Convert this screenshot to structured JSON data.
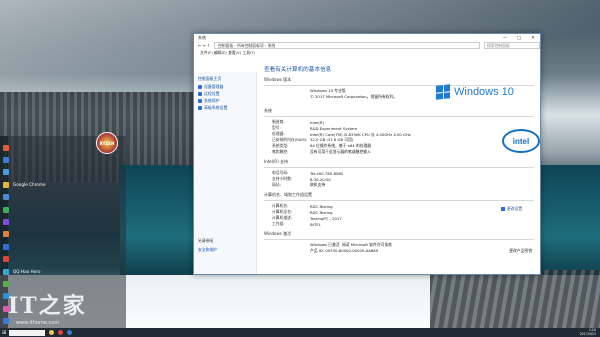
{
  "watermark": {
    "text": "IT之家",
    "site": "www.ithome.com"
  },
  "avatar_label": "RYZEN",
  "start_menu": {
    "apps": [
      {
        "label": "",
        "color": "#e35d3a"
      },
      {
        "label": "",
        "color": "#3a7bd5"
      },
      {
        "label": "",
        "color": "#4a9be0"
      },
      {
        "label": "Google Chrome",
        "color": "#e0b83b"
      },
      {
        "label": "",
        "color": "#4c8ad9"
      },
      {
        "label": "",
        "color": "#3fae5c"
      },
      {
        "label": "",
        "color": "#7d4cd9"
      },
      {
        "label": "",
        "color": "#e0803b"
      },
      {
        "label": "",
        "color": "#2f6fd6"
      },
      {
        "label": "",
        "color": "#d9443b"
      },
      {
        "label": "QQ Hao Hero",
        "color": "#3aa6d5"
      },
      {
        "label": "",
        "color": "#53b04c"
      },
      {
        "label": "",
        "color": "#2d8fd6"
      },
      {
        "label": "",
        "color": "#e05bb0"
      },
      {
        "label": "",
        "color": "#3a7bd5"
      }
    ]
  },
  "taskbar": {
    "search_placeholder": "",
    "time": "1:10",
    "date": "2017/4/21"
  },
  "window": {
    "title": "系统",
    "min": "—",
    "max": "□",
    "close": "✕",
    "ribbon": "文件(F)   编辑(E)   查看(V)   工具(T)",
    "breadcrumb": "控制面板  ›  所有控制面板项  ›  系统",
    "search_placeholder": "搜索控制面板",
    "left_home": "控制面板主页",
    "left_items": [
      "设备管理器",
      "远程设置",
      "系统保护",
      "高级系统设置"
    ],
    "left_bottom_title": "另请参阅",
    "left_bottom_link": "安全和维护",
    "heading": "查看有关计算机的基本信息",
    "edition_section": "Windows 版本",
    "edition": "Windows 10 专业版",
    "copyright": "© 2017 Microsoft Corporation。保留所有权利。",
    "windows_logo_text": "Windows 10",
    "system_section": "系统",
    "system_rows": [
      {
        "k": "制造商:",
        "v": "Intel(R)"
      },
      {
        "k": "型号:",
        "v": "R&D Experiment System"
      },
      {
        "k": "处理器:",
        "v": "Intel(R) Core(TM) i5-8350K CPU @ 4.00GHz   4.00 GHz"
      },
      {
        "k": "已安装的内存(RAM):",
        "v": "32.0 GB (31.8 GB 可用)"
      },
      {
        "k": "系统类型:",
        "v": "64 位操作系统，基于 x64 的处理器"
      },
      {
        "k": "笔和触控:",
        "v": "没有可用于此显示器的笔或触控输入"
      }
    ],
    "intel_logo_text": "intel",
    "support_section": "Intel(R) 支持",
    "support_rows": [
      {
        "k": "电话号码:",
        "v": "Tel:400-765-8080"
      },
      {
        "k": "支持小时数:",
        "v": "8:30-20:00"
      },
      {
        "k": "网站:",
        "v": "联机支持",
        "link": true
      }
    ],
    "computer_section": "计算机名、域和工作组设置",
    "computer_rows": [
      {
        "k": "计算机名:",
        "v": "RDC-Testing"
      },
      {
        "k": "计算机全名:",
        "v": "RDC-Testing"
      },
      {
        "k": "计算机描述:",
        "v": "TestingPC - 2017"
      },
      {
        "k": "工作组:",
        "v": "INTEL"
      }
    ],
    "change_settings": "更改设置",
    "activation_section": "Windows 激活",
    "activation_text": "Windows 已激活",
    "activation_link": "阅读 Microsoft 软件许可条款",
    "product_id": "产品 ID: 00330-80000-00000-AA689",
    "change_key": "更改产品密钥"
  }
}
